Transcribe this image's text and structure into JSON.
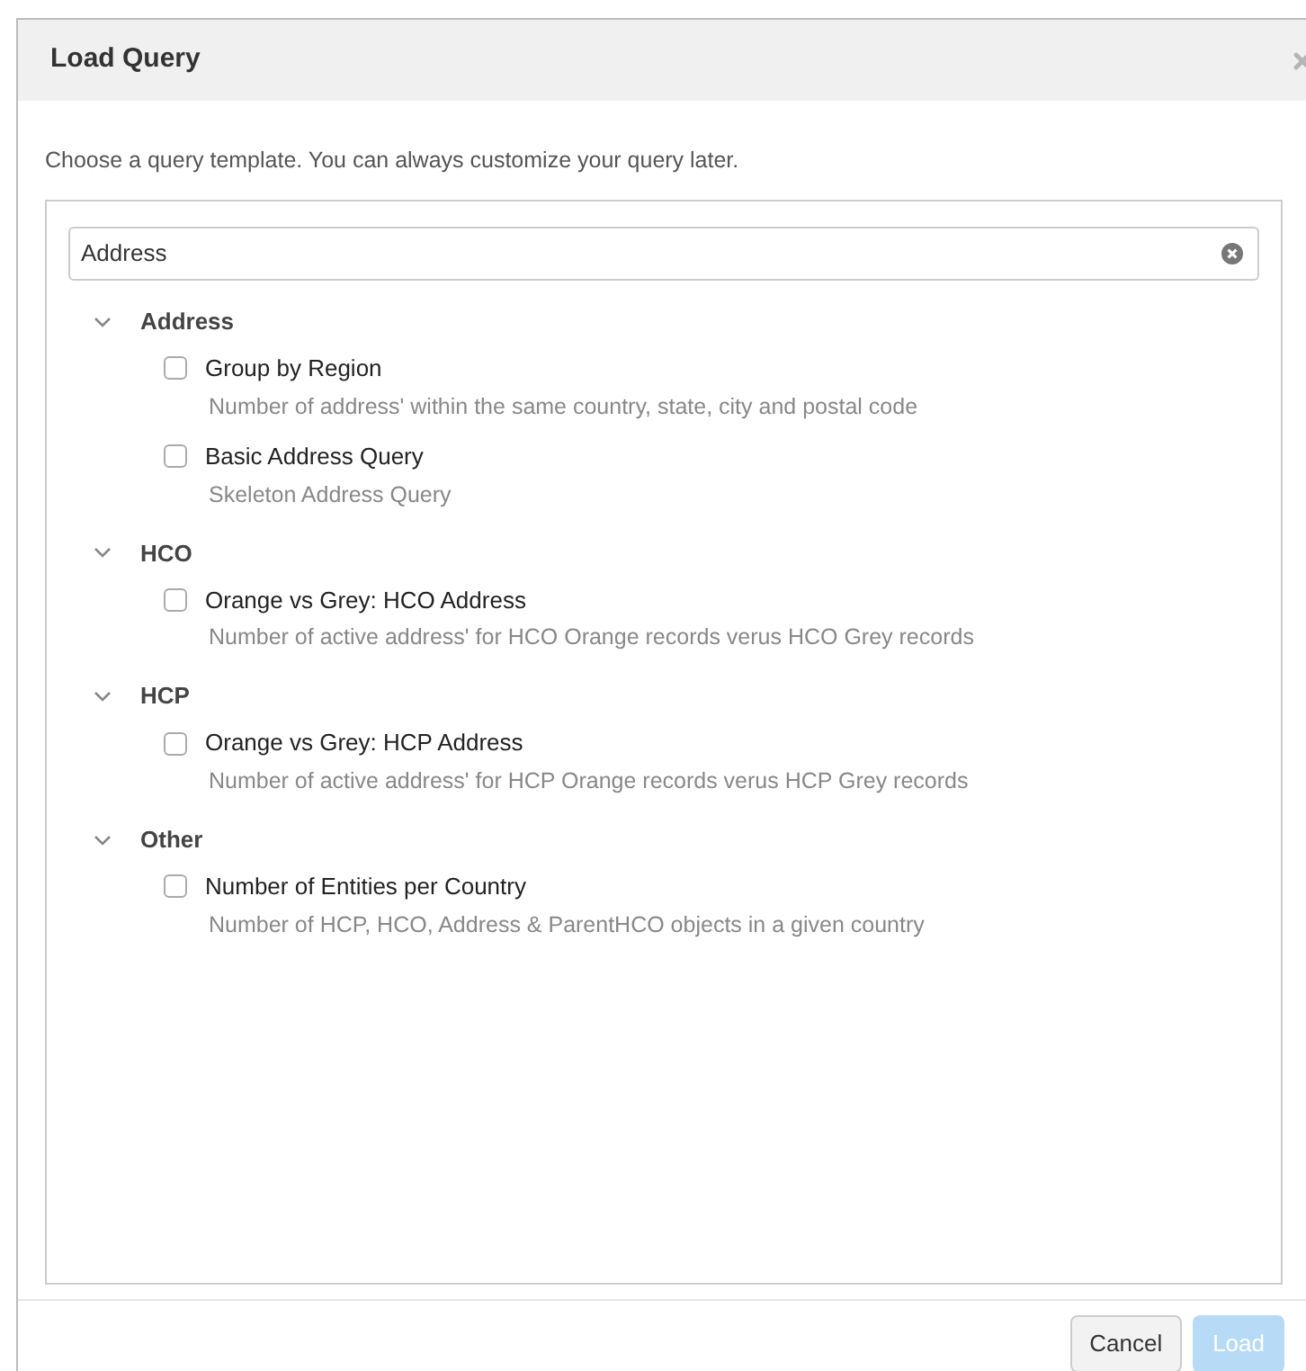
{
  "dialog": {
    "title": "Load Query",
    "description": "Choose a query template. You can always customize your query later."
  },
  "search": {
    "value": "Address"
  },
  "groups": [
    {
      "name": "Address",
      "expanded": true,
      "items": [
        {
          "label": "Group by Region",
          "checked": false,
          "description": "Number of address' within the same country, state, city and postal code"
        },
        {
          "label": "Basic Address Query",
          "checked": false,
          "description": "Skeleton Address Query"
        }
      ]
    },
    {
      "name": "HCO",
      "expanded": true,
      "items": [
        {
          "label": "Orange vs Grey: HCO Address",
          "checked": false,
          "description": "Number of active address' for HCO Orange records verus HCO Grey records"
        }
      ]
    },
    {
      "name": "HCP",
      "expanded": true,
      "items": [
        {
          "label": "Orange vs Grey: HCP Address",
          "checked": false,
          "description": "Number of active address' for HCP Orange records verus HCP Grey records"
        }
      ]
    },
    {
      "name": "Other",
      "expanded": true,
      "items": [
        {
          "label": "Number of Entities per Country",
          "checked": false,
          "description": "Number of HCP, HCO, Address & ParentHCO objects in a given country"
        }
      ]
    }
  ],
  "buttons": [
    {
      "label": "Cancel",
      "kind": "secondary",
      "disabled": false
    },
    {
      "label": "Load",
      "kind": "primary",
      "disabled": true
    }
  ]
}
